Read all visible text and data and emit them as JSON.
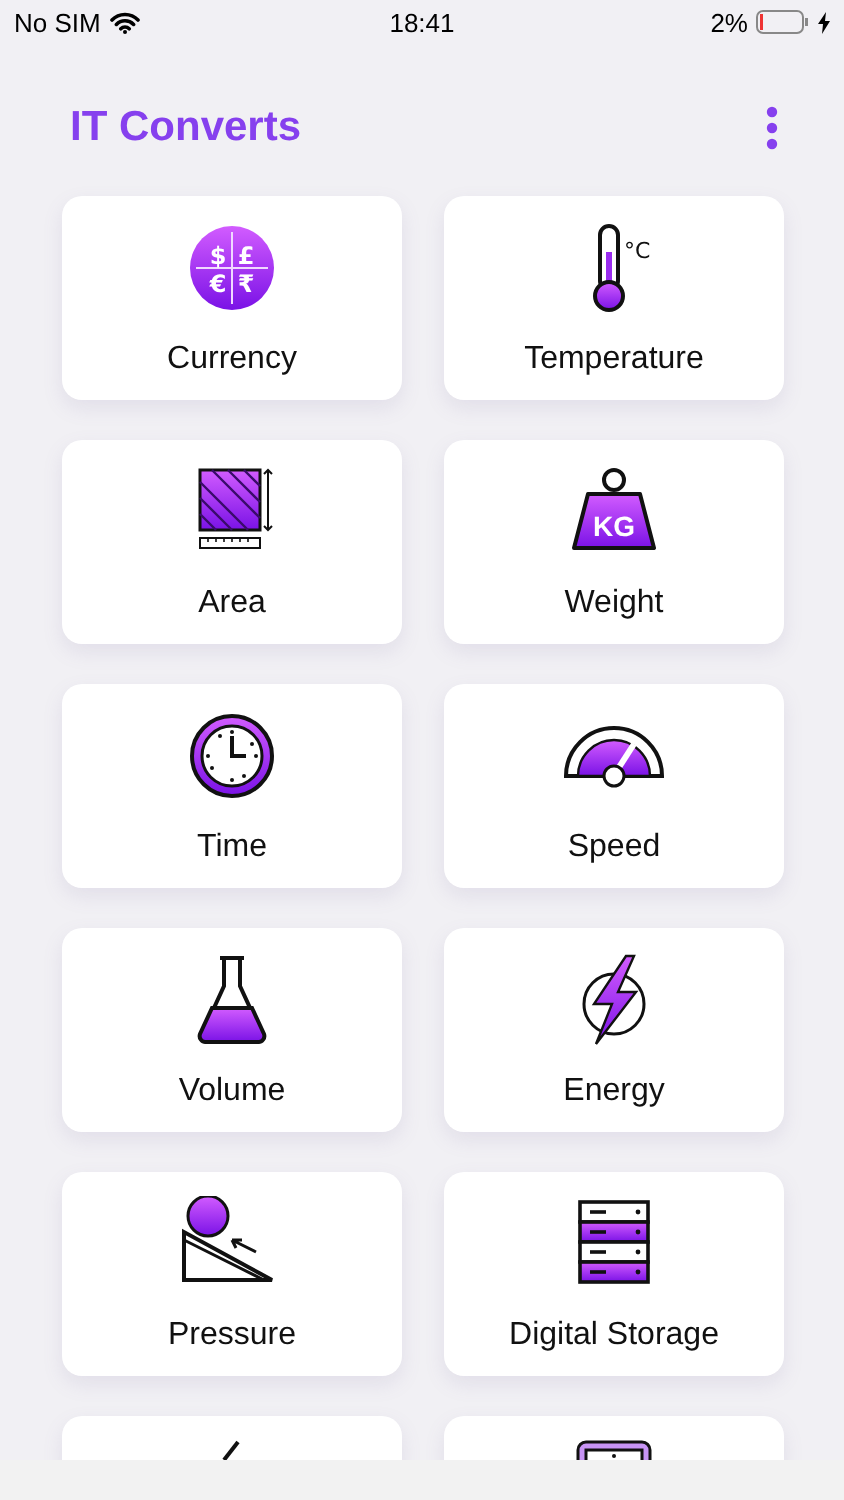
{
  "status_bar": {
    "carrier": "No SIM",
    "time": "18:41",
    "battery": "2%"
  },
  "header": {
    "title": "IT Converts"
  },
  "tiles": [
    {
      "kind": "currency",
      "label": "Currency"
    },
    {
      "kind": "temperature",
      "label": "Temperature"
    },
    {
      "kind": "area",
      "label": "Area"
    },
    {
      "kind": "weight",
      "label": "Weight"
    },
    {
      "kind": "time",
      "label": "Time"
    },
    {
      "kind": "speed",
      "label": "Speed"
    },
    {
      "kind": "volume",
      "label": "Volume"
    },
    {
      "kind": "energy",
      "label": "Energy"
    },
    {
      "kind": "pressure",
      "label": "Pressure"
    },
    {
      "kind": "storage",
      "label": "Digital Storage"
    },
    {
      "kind": "slash"
    },
    {
      "kind": "frame"
    }
  ],
  "icon_texts": {
    "currency": [
      "$",
      "£",
      "€",
      "₹"
    ],
    "temperature": [
      "°C"
    ],
    "weight": [
      "KG"
    ]
  }
}
